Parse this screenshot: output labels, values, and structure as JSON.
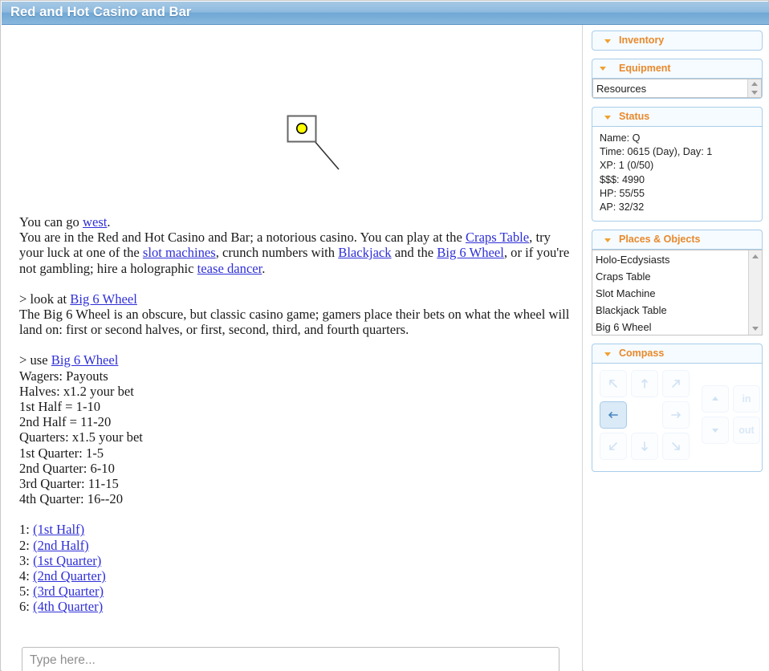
{
  "window": {
    "title": "Red and Hot Casino and Bar",
    "titlebar_color": "#8fbbdf"
  },
  "map": {
    "room_marker_icon": "player-dot",
    "marker_color": "#ffff00",
    "room_outline_color": "#666666",
    "corridor_color": "#333333"
  },
  "story": {
    "exits_line_prefix": "You can go ",
    "exits_link": "west",
    "exits_line_suffix": ".",
    "room_desc_1": "You are in the Red and Hot Casino and Bar; a notorious casino. You can play at the ",
    "room_link_craps": "Craps Table",
    "room_desc_2": ", try your luck at one of the ",
    "room_link_slots": "slot machines",
    "room_desc_3": ", crunch numbers with ",
    "room_link_blackjack": "Blackjack",
    "room_desc_4": " and the ",
    "room_link_bigwheel": "Big 6 Wheel",
    "room_desc_5": ", or if you're not gambling; hire a holographic ",
    "room_link_tease": "tease dancer",
    "room_desc_6": ".",
    "cmd_look_prefix": "> look at ",
    "cmd_look_link": "Big 6 Wheel",
    "look_desc": "The Big 6 Wheel is an obscure, but classic casino game; gamers place their bets on what the wheel will land on: first or second halves, or first, second, third, and fourth quarters.",
    "cmd_use_prefix": "> use ",
    "cmd_use_link": "Big 6 Wheel",
    "payout_lines": [
      "Wagers: Payouts",
      "Halves: x1.2 your bet",
      "1st Half = 1-10",
      "2nd Half = 11-20",
      "Quarters: x1.5 your bet",
      "1st Quarter: 1-5",
      "2nd Quarter: 6-10",
      "3rd Quarter: 11-15",
      "4th Quarter: 16--20"
    ],
    "choices": [
      {
        "number": "1:",
        "label": "(1st Half)"
      },
      {
        "number": "2:",
        "label": "(2nd Half)"
      },
      {
        "number": "3:",
        "label": "(1st Quarter)"
      },
      {
        "number": "4:",
        "label": "(2nd Quarter)"
      },
      {
        "number": "5:",
        "label": "(3rd Quarter)"
      },
      {
        "number": "6:",
        "label": "(4th Quarter)"
      }
    ],
    "link_color": "#2f2fd8"
  },
  "input": {
    "placeholder": "Type here...",
    "value": ""
  },
  "sidebar": {
    "accent_color": "#e8892b",
    "border_color": "#a8cdea",
    "panels": {
      "inventory": {
        "title": "Inventory",
        "collapse_icon": "caret-down-icon"
      },
      "equipment": {
        "title": "Equipment",
        "collapse_icon": "caret-down-icon",
        "resources_label": "Resources"
      },
      "status": {
        "title": "Status",
        "collapse_icon": "caret-down-icon",
        "lines": [
          "Name: Q",
          "Time: 0615 (Day), Day: 1",
          "XP: 1 (0/50)",
          "$$$: 4990",
          "HP: 55/55",
          "AP: 32/32"
        ]
      },
      "places": {
        "title": "Places & Objects",
        "collapse_icon": "caret-down-icon",
        "items": [
          "Holo-Ecdysiasts",
          "Craps Table",
          "Slot Machine",
          "Blackjack Table",
          "Big 6 Wheel"
        ]
      },
      "compass": {
        "title": "Compass",
        "collapse_icon": "caret-down-icon",
        "buttons": [
          {
            "name": "northwest",
            "glyph": "arrow-nw",
            "active": false,
            "label": ""
          },
          {
            "name": "north",
            "glyph": "arrow-n",
            "active": false,
            "label": ""
          },
          {
            "name": "northeast",
            "glyph": "arrow-ne",
            "active": false,
            "label": ""
          },
          {
            "name": "west",
            "glyph": "arrow-w",
            "active": true,
            "label": ""
          },
          {
            "name": "east",
            "glyph": "arrow-e",
            "active": false,
            "label": ""
          },
          {
            "name": "southwest",
            "glyph": "arrow-sw",
            "active": false,
            "label": ""
          },
          {
            "name": "south",
            "glyph": "arrow-s",
            "active": false,
            "label": ""
          },
          {
            "name": "southeast",
            "glyph": "arrow-se",
            "active": false,
            "label": ""
          },
          {
            "name": "up",
            "glyph": "triangle-up",
            "active": false,
            "label": ""
          },
          {
            "name": "down",
            "glyph": "triangle-down",
            "active": false,
            "label": ""
          },
          {
            "name": "in",
            "glyph": "text",
            "active": false,
            "label": "in"
          },
          {
            "name": "out",
            "glyph": "text",
            "active": false,
            "label": "out"
          }
        ]
      }
    }
  }
}
